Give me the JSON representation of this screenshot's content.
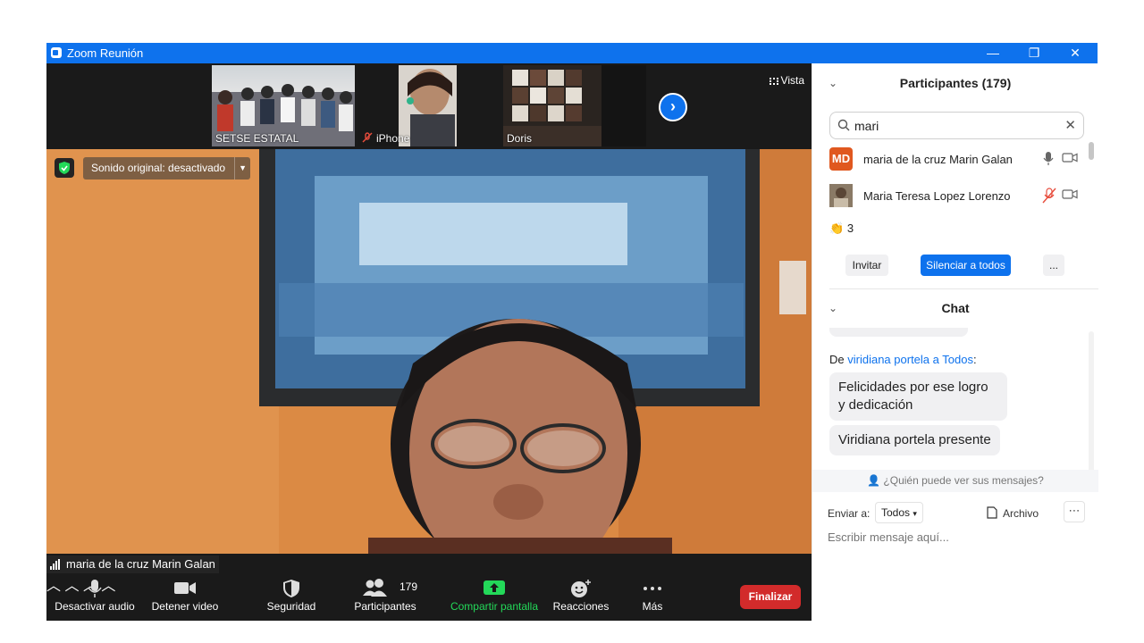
{
  "window": {
    "title": "Zoom Reunión",
    "minimize": "—",
    "restore": "❐",
    "close": "✕"
  },
  "thumbnails": [
    {
      "label": "SETSE ESTATAL",
      "muted": false
    },
    {
      "label": "iPhone",
      "muted": true
    },
    {
      "label": "Doris",
      "muted": false
    }
  ],
  "view_button": "Vista",
  "main_video": {
    "original_sound": "Sonido original: desactivado",
    "speaker_name": "maria de la cruz Marin Galan"
  },
  "toolbar": {
    "audio": "Desactivar audio",
    "video": "Detener video",
    "security": "Seguridad",
    "participants": "Participantes",
    "participants_count": "179",
    "share": "Compartir pantalla",
    "reactions": "Reacciones",
    "more": "Más",
    "end": "Finalizar"
  },
  "participants_panel": {
    "title": "Participantes (179)",
    "search_value": "mari",
    "rows": [
      {
        "initials": "MD",
        "name": "maria de la cruz Marin Galan",
        "avatar_color": "#e0581f",
        "muted": false
      },
      {
        "initials": "",
        "name": "Maria Teresa Lopez Lorenzo",
        "avatar_color": "#7a6a55",
        "muted": true
      }
    ],
    "clap_count": "3",
    "invite": "Invitar",
    "mute_all": "Silenciar a todos",
    "more": "..."
  },
  "chat": {
    "title": "Chat",
    "from_prefix": "De",
    "from_name": "viridiana portela",
    "to_word": "a",
    "to_name": "Todos",
    "messages": [
      "Felicidades por ese logro y dedicación",
      "Viridiana portela presente"
    ],
    "who_can_see": "¿Quién puede ver sus mensajes?",
    "send_to_label": "Enviar a:",
    "send_to_value": "Todos",
    "file": "Archivo",
    "input_placeholder": "Escribir mensaje aquí..."
  },
  "colors": {
    "zoom_blue": "#0e72ed",
    "end_red": "#d22b2b",
    "share_green": "#23d959"
  }
}
